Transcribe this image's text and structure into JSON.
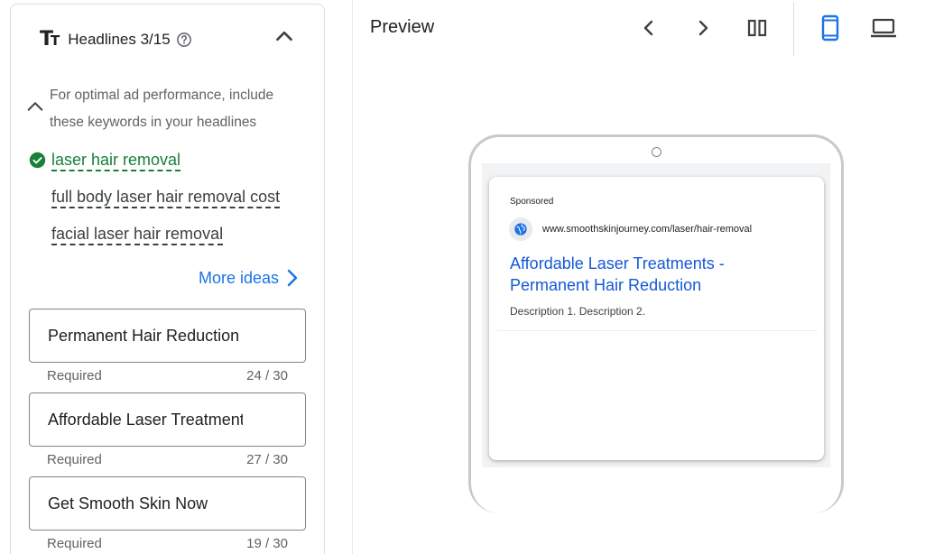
{
  "headlines": {
    "title": "Headlines 3/15",
    "keyword_hint": "For optimal ad performance, include these keywords in your headlines",
    "keywords": [
      {
        "text": "laser hair removal",
        "included": true
      },
      {
        "text": "full body laser hair removal cost",
        "included": false
      },
      {
        "text": "facial laser hair removal",
        "included": false
      }
    ],
    "more_ideas": "More ideas",
    "inputs": [
      {
        "value": "Permanent Hair Reduction",
        "helper": "Required",
        "count": "24 / 30"
      },
      {
        "value": "Affordable Laser Treatments",
        "helper": "Required",
        "count": "27 / 30"
      },
      {
        "value": "Get Smooth Skin Now",
        "helper": "Required",
        "count": "19 / 30"
      }
    ]
  },
  "preview": {
    "title": "Preview",
    "ad": {
      "sponsored": "Sponsored",
      "url": "www.smoothskinjourney.com/laser/hair-removal",
      "headline": "Affordable Laser Treatments - Permanent Hair Reduction",
      "description": "Description 1. Description 2."
    },
    "selected_device": "mobile"
  },
  "colors": {
    "accent": "#1a73e8",
    "success": "#188038",
    "headline_link": "#1558d6"
  },
  "icons": {
    "headline_type": "text-size-icon",
    "help": "help-circle-icon",
    "collapse": "chevron-up-icon",
    "check": "check-circle-icon",
    "more": "chevron-right-icon",
    "prev": "chevron-left-icon",
    "next": "chevron-right-icon",
    "split": "split-view-icon",
    "mobile": "smartphone-icon",
    "desktop": "laptop-icon",
    "globe": "globe-icon"
  }
}
